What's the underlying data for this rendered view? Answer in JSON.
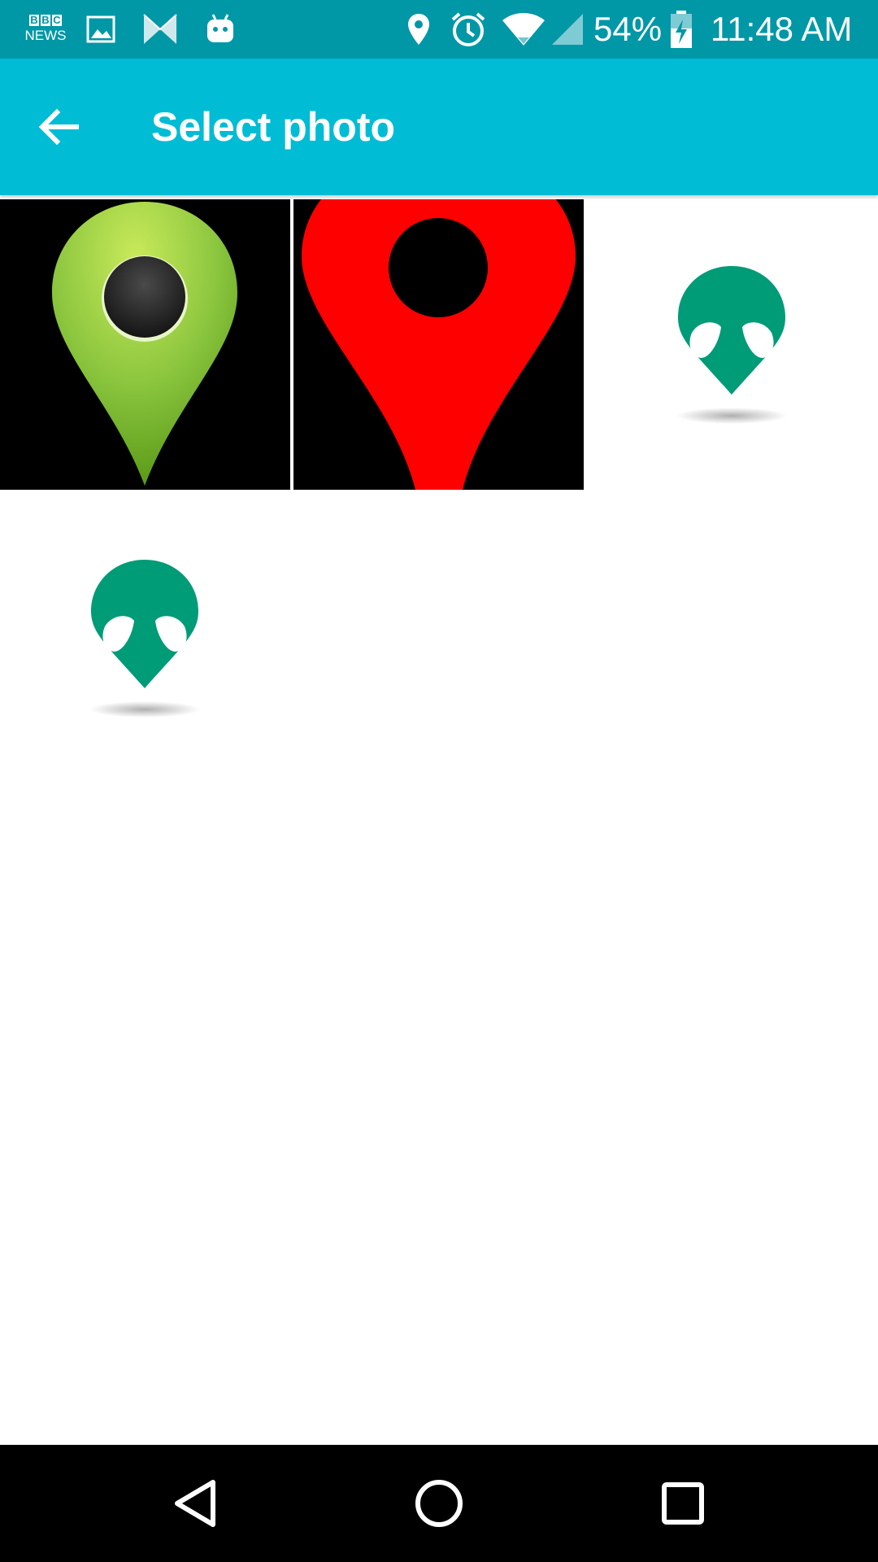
{
  "status_bar": {
    "battery": "54%",
    "time": "11:48 AM",
    "bbc_line1": "BBC",
    "bbc_line2": "NEWS",
    "icons": [
      "bbc-news-icon",
      "gallery-icon",
      "butterfly-app-icon",
      "android-icon",
      "location-icon",
      "alarm-icon",
      "wifi-icon",
      "cell-signal-icon",
      "battery-charging-icon"
    ]
  },
  "app_bar": {
    "title": "Select photo",
    "back_icon": "arrow-back-icon",
    "color": "#00BCD4"
  },
  "photos": [
    {
      "name": "green-map-pin",
      "pin_color": "#8CC63F",
      "background": "#000000"
    },
    {
      "name": "red-map-pin",
      "pin_color": "#FF0000",
      "background": "#000000"
    },
    {
      "name": "alien-marker",
      "marker_color": "#009B77",
      "background": "#FFFFFF"
    },
    {
      "name": "alien-marker",
      "marker_color": "#009B77",
      "background": "#FFFFFF"
    }
  ],
  "colors": {
    "status_bar": "#0097A7",
    "nav_bar": "#000000"
  },
  "nav_bar": {
    "buttons": [
      "back-triangle-icon",
      "home-circle-icon",
      "recents-square-icon"
    ]
  }
}
